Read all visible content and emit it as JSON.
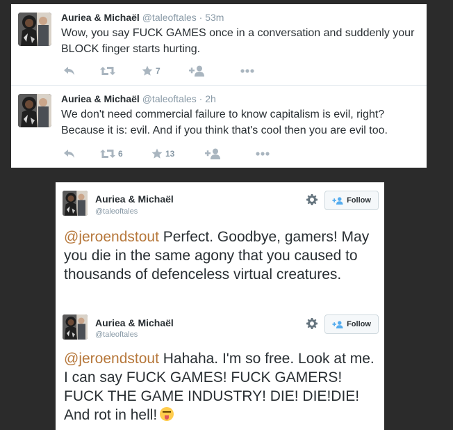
{
  "timeline": {
    "tweets": [
      {
        "name": "Auriea & Michaël",
        "handle": "@taleoftales",
        "time": "· 53m",
        "text": "Wow, you say FUCK GAMES once in a conversation and suddenly your BLOCK finger starts hurting.",
        "retweets": "",
        "favorites": "7"
      },
      {
        "name": "Auriea & Michaël",
        "handle": "@taleoftales",
        "time": "· 2h",
        "text": "We don't need commercial failure to know capitalism is evil, right? Because it is: evil. And if you think that's cool then you are evil too.",
        "retweets": "6",
        "favorites": "13"
      }
    ]
  },
  "embedded": [
    {
      "name": "Auriea & Michaël",
      "handle": "@taleoftales",
      "follow_label": "Follow",
      "mention": "@jeroendstout",
      "text": " Perfect. Goodbye, gamers! May you die in the same agony that you caused to thousands of defenceless virtual creatures."
    },
    {
      "name": "Auriea & Michaël",
      "handle": "@taleoftales",
      "follow_label": "Follow",
      "mention": "@jeroendstout",
      "text": " Hahaha. I'm so free. Look at me. I can say FUCK GAMES! FUCK GAMERS! FUCK THE GAME INDUSTRY! DIE! DIE!DIE! And rot in hell!",
      "emoji": "squinting-tongue-emoji"
    }
  ],
  "colors": {
    "background": "#2b2b2b",
    "card": "#ffffff",
    "text": "#292f33",
    "muted": "#8899a6",
    "icon": "#a9b5bf",
    "mention": "#b6773a"
  },
  "icons": [
    "reply-icon",
    "retweet-icon",
    "favorite-icon",
    "follow-icon",
    "more-icon",
    "gear-icon"
  ]
}
